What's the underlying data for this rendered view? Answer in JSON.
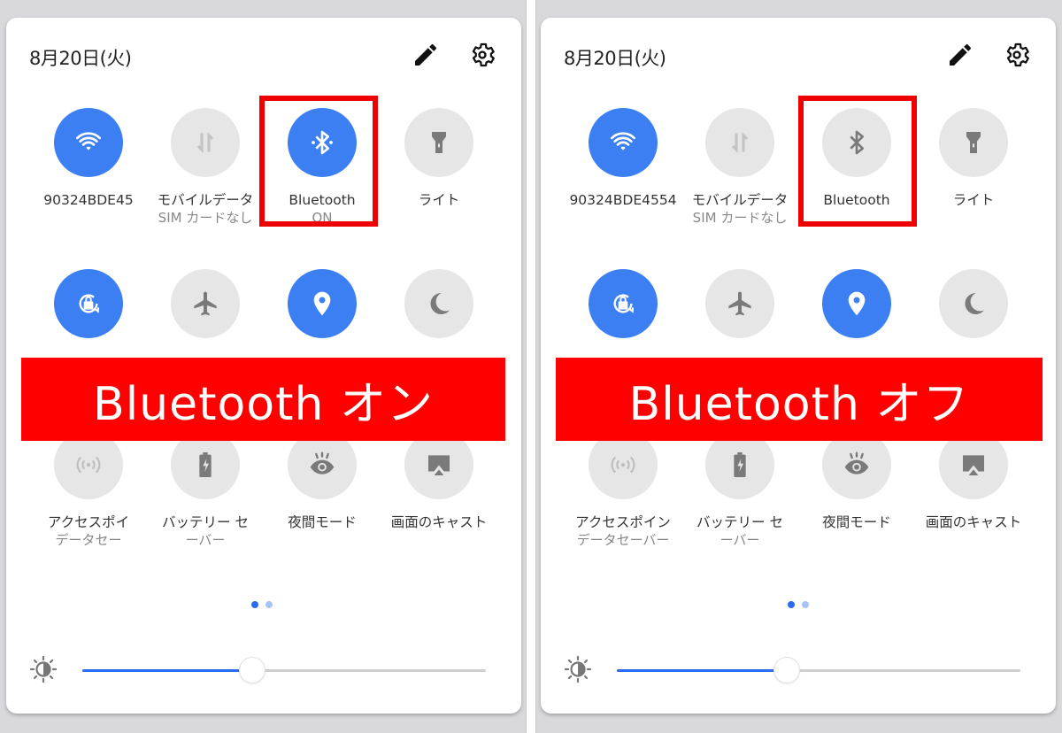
{
  "colors": {
    "tile_on": "#3c7ff2",
    "tile_off": "#e6e6e6",
    "highlight_border": "#ee0000",
    "banner_bg": "#ff0000",
    "accent": "#2a6cf0"
  },
  "panels": [
    {
      "date": "8月20日(火)",
      "edit_icon": "pencil-icon",
      "settings_icon": "gear-icon",
      "banner": "Bluetooth オン",
      "tiles": [
        {
          "icon": "wifi-icon",
          "label": "90324BDE45",
          "sub": "",
          "state": "on"
        },
        {
          "icon": "mobile-data-icon",
          "label": "モバイルデータ",
          "sub": "SIM カードなし",
          "state": "off"
        },
        {
          "icon": "bluetooth-icon",
          "label": "Bluetooth",
          "sub": "ON",
          "state": "on"
        },
        {
          "icon": "flashlight-icon",
          "label": "ライト",
          "sub": "",
          "state": "off"
        },
        {
          "icon": "auto-rotate-icon",
          "label": "",
          "sub": "",
          "state": "on"
        },
        {
          "icon": "airplane-icon",
          "label": "",
          "sub": "",
          "state": "off"
        },
        {
          "icon": "location-icon",
          "label": "",
          "sub": "",
          "state": "on"
        },
        {
          "icon": "moon-icon",
          "label": "",
          "sub": "",
          "state": "off"
        },
        {
          "icon": "hotspot-icon",
          "label": "アクセスポイ",
          "sub": "データセー",
          "state": "off"
        },
        {
          "icon": "battery-saver-icon",
          "label": "バッテリー セ",
          "sub": "ーバー",
          "state": "off"
        },
        {
          "icon": "eye-icon",
          "label": "夜間モード",
          "sub": "",
          "state": "off"
        },
        {
          "icon": "cast-icon",
          "label": "画面のキャスト",
          "sub": "",
          "state": "off"
        }
      ],
      "page_indicator": {
        "current": 1,
        "total": 2
      },
      "brightness": {
        "icon": "brightness-icon",
        "value": 0.42
      }
    },
    {
      "date": "8月20日(火)",
      "edit_icon": "pencil-icon",
      "settings_icon": "gear-icon",
      "banner": "Bluetooth オフ",
      "tiles": [
        {
          "icon": "wifi-icon",
          "label": "90324BDE4554",
          "sub": "",
          "state": "on"
        },
        {
          "icon": "mobile-data-icon",
          "label": "モバイルデータ",
          "sub": "SIM カードなし",
          "state": "off"
        },
        {
          "icon": "bluetooth-icon",
          "label": "Bluetooth",
          "sub": "",
          "state": "off"
        },
        {
          "icon": "flashlight-icon",
          "label": "ライト",
          "sub": "",
          "state": "off"
        },
        {
          "icon": "auto-rotate-icon",
          "label": "",
          "sub": "",
          "state": "on"
        },
        {
          "icon": "airplane-icon",
          "label": "",
          "sub": "",
          "state": "off"
        },
        {
          "icon": "location-icon",
          "label": "",
          "sub": "",
          "state": "on"
        },
        {
          "icon": "moon-icon",
          "label": "",
          "sub": "",
          "state": "off"
        },
        {
          "icon": "hotspot-icon",
          "label": "アクセスポイン",
          "sub": "データセーバー",
          "state": "off"
        },
        {
          "icon": "battery-saver-icon",
          "label": "バッテリー セ",
          "sub": "ーバー",
          "state": "off"
        },
        {
          "icon": "eye-icon",
          "label": "夜間モード",
          "sub": "",
          "state": "off"
        },
        {
          "icon": "cast-icon",
          "label": "画面のキャスト",
          "sub": "",
          "state": "off"
        }
      ],
      "page_indicator": {
        "current": 1,
        "total": 2
      },
      "brightness": {
        "icon": "brightness-icon",
        "value": 0.42
      }
    }
  ]
}
